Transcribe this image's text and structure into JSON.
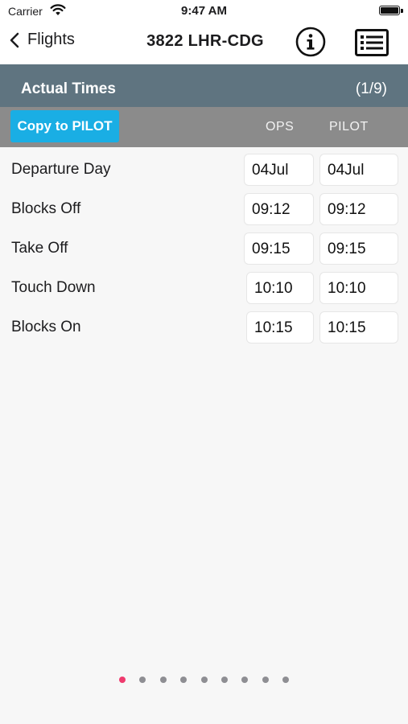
{
  "status": {
    "carrier": "Carrier",
    "time": "9:47 AM"
  },
  "nav": {
    "back_label": "Flights",
    "title": "3822 LHR-CDG",
    "info_icon": "info-icon",
    "list_icon": "list-icon"
  },
  "section": {
    "title": "Actual Times",
    "count": "(1/9)",
    "color": "#5f7480"
  },
  "toolbar": {
    "copy_label": "Copy to PILOT",
    "col_ops": "OPS",
    "col_pilot": "PILOT",
    "accent": "#1aaee4"
  },
  "rows": [
    {
      "label": "Departure Day",
      "ops": "04Jul",
      "pilot": "04Jul"
    },
    {
      "label": "Blocks Off",
      "ops": "09:12",
      "pilot": "09:12"
    },
    {
      "label": "Take Off",
      "ops": "09:15",
      "pilot": "09:15"
    },
    {
      "label": "Touch Down",
      "ops": "10:10",
      "pilot": "10:10"
    },
    {
      "label": "Blocks On",
      "ops": "10:15",
      "pilot": "10:15"
    }
  ],
  "pager": {
    "total": 9,
    "current": 1,
    "active_color": "#ef3b6e"
  }
}
